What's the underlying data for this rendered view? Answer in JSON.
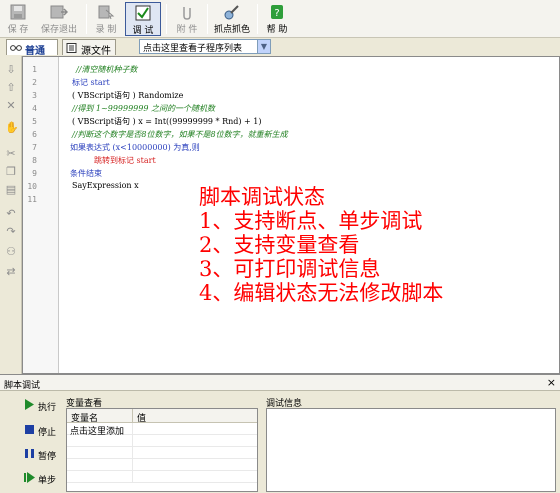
{
  "toolbar": {
    "save": "保 存",
    "save_exit": "保存退出",
    "record": "录 制",
    "debug": "调 试",
    "attachment": "附 件",
    "pick_color": "抓点抓色",
    "help": "帮 助"
  },
  "tabs": {
    "normal": "普通",
    "source": "源文件"
  },
  "proc_select": {
    "value": "点击这里查看子程序列表"
  },
  "code": {
    "line_numbers": [
      "1",
      "2",
      "3",
      "4",
      "5",
      "6",
      "7",
      "8",
      "9",
      "10",
      "11"
    ],
    "l1": "//清空随机种子数",
    "l2": "标记 start",
    "l3": "( VBScript语句 ) Randomize",
    "l4": "//得到 1~99999999 之间的一个随机数",
    "l5": "( VBScript语句 ) x = Int((99999999 * Rnd) + 1)",
    "l6": "//判断这个数字是否8位数字，如果不是8位数字，就重新生成",
    "l7": "如果表达式 (x<10000000) 为真,则",
    "l8": "跳转到标记 start",
    "l9": "条件结束",
    "l10": "SayExpression x"
  },
  "overlay": {
    "line1": "脚本调试状态",
    "line2": "1、支持断点、单步调试",
    "line3": "2、支持变量查看",
    "line4": "3、可打印调试信息",
    "line5": "4、编辑状态无法修改脚本"
  },
  "debug_pane": {
    "title": "脚本调试",
    "close": "×",
    "run": "执行",
    "stop": "停止",
    "pause": "暂停",
    "step": "单步",
    "var_title": "变量查看",
    "var_col_name": "变量名",
    "var_col_value": "值",
    "var_add": "点击这里添加",
    "info_title": "调试信息"
  },
  "colors": {
    "accent_blue": "#1c3f94",
    "overlay_red": "#ff0000",
    "comment_green": "#1f7f1f",
    "keyword_blue": "#2a3fbd"
  }
}
